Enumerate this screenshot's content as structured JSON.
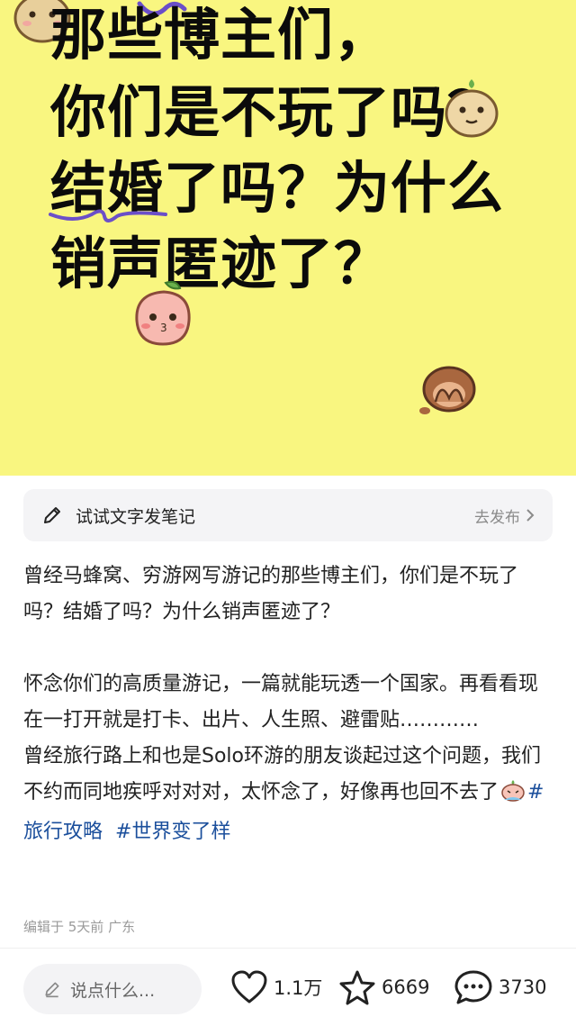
{
  "cover": {
    "line1": "那些博主们，",
    "line2": "你们是不玩了吗？",
    "line3": "结婚了吗？为什么",
    "line4": "销声匿迹了？",
    "bg_color": "#f9f680"
  },
  "tip_bar": {
    "text": "试试文字发笔记",
    "action": "去发布"
  },
  "note": {
    "para1": "曾经马蜂窝、穷游网写游记的那些博主们，你们是不玩了吗？结婚了吗？为什么销声匿迹了？",
    "para2": "怀念你们的高质量游记，一篇就能玩透一个国家。再看看现在一打开就是打卡、出片、人生照、避雷贴…………",
    "para3": "曾经旅行路上和也是Solo环游的朋友谈起过这个问题，我们不约而同地疾呼对对对，太怀念了，好像再也回不去了",
    "tags": [
      "#旅行攻略",
      "#世界变了样"
    ],
    "tag_color": "#1b4f9c"
  },
  "meta": "编辑于 5天前 广东",
  "bottom": {
    "comment_placeholder": "说点什么...",
    "likes": "1.1万",
    "stars": "6669",
    "comments": "3730"
  },
  "icons": [
    "pencil-icon",
    "chevron-right-icon",
    "heart-icon",
    "star-icon",
    "comment-bubble-icon",
    "crying-emoji-icon",
    "cute-face-sticker-icon"
  ]
}
